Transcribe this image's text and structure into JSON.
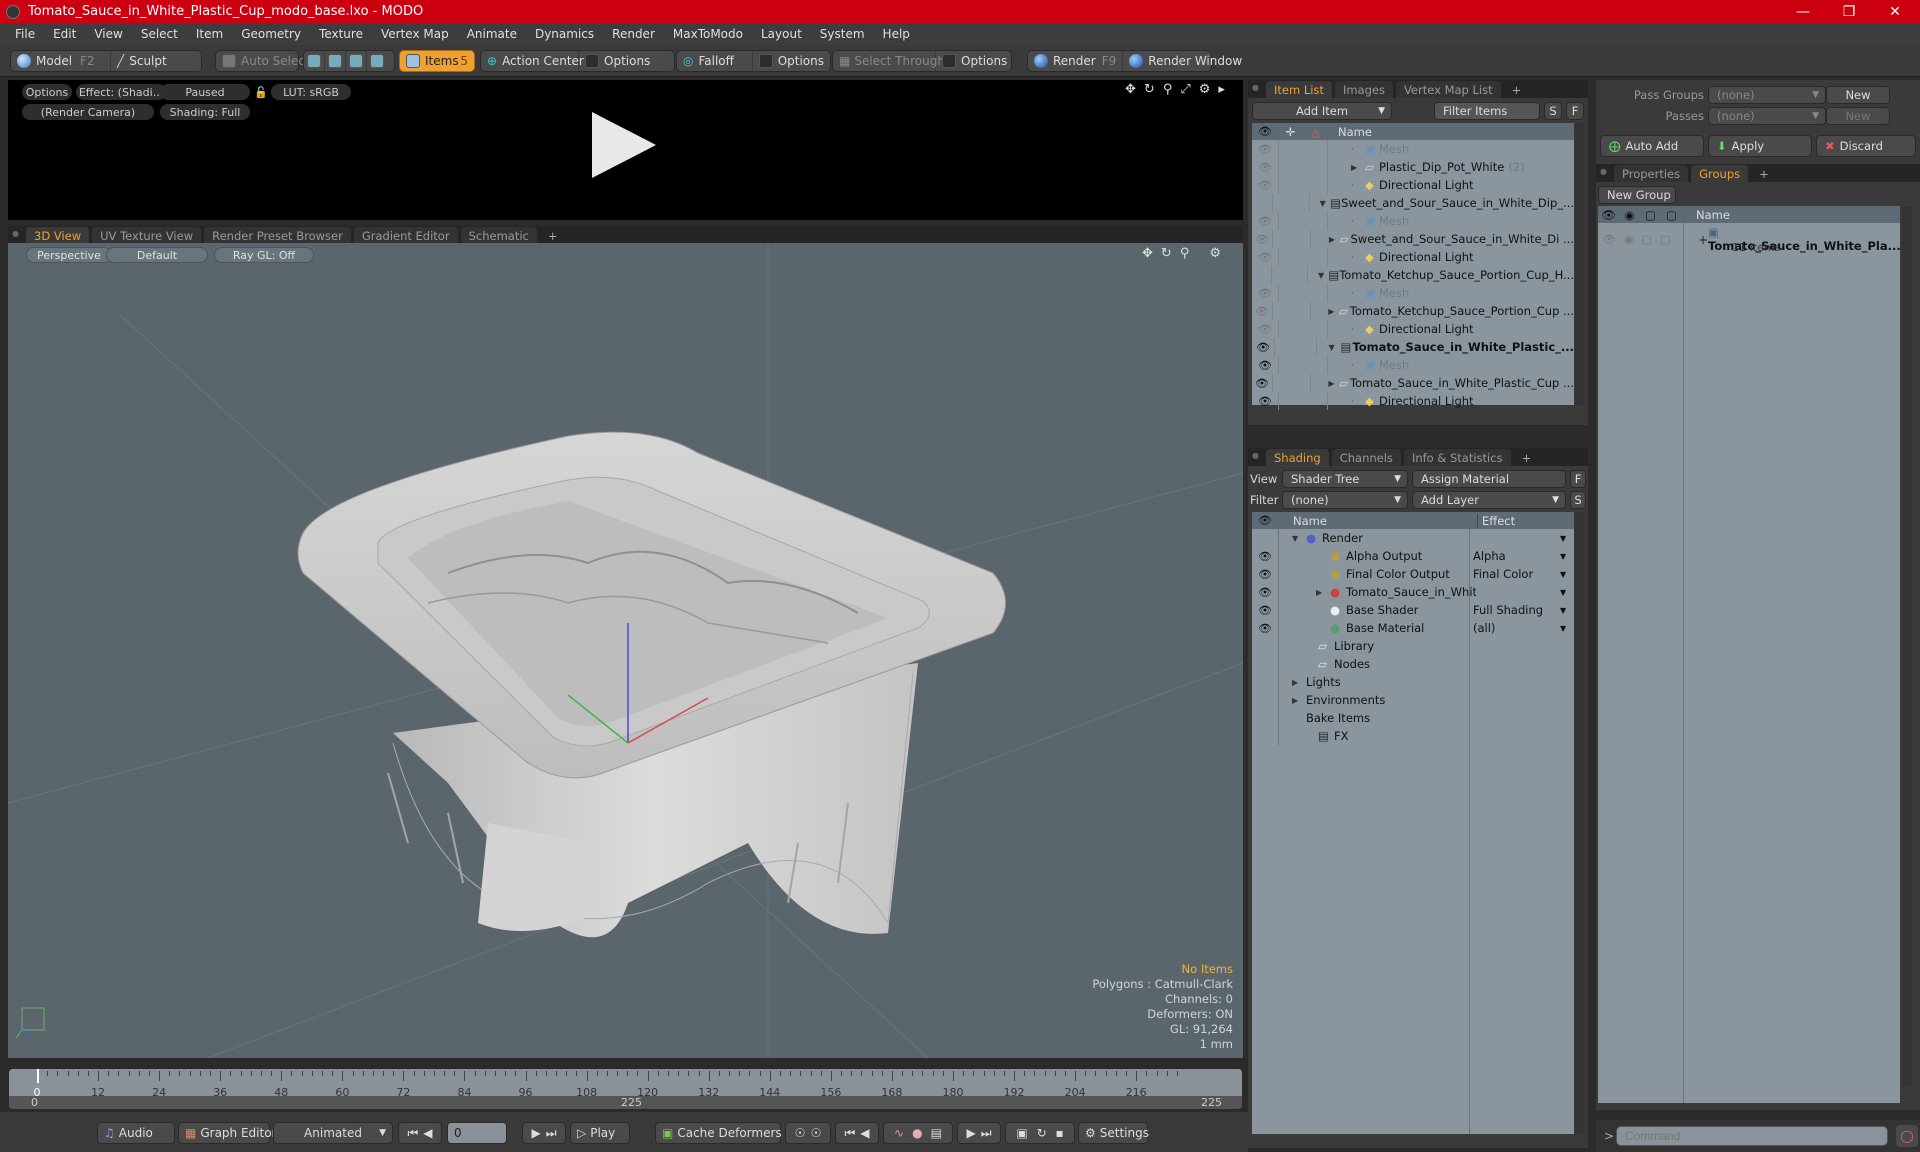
{
  "window": {
    "title": "Tomato_Sauce_in_White_Plastic_Cup_modo_base.lxo - MODO",
    "controls": [
      "minimize",
      "restore",
      "close"
    ]
  },
  "menu": [
    "File",
    "Edit",
    "View",
    "Select",
    "Item",
    "Geometry",
    "Texture",
    "Vertex Map",
    "Animate",
    "Dynamics",
    "Render",
    "MaxToModo",
    "Layout",
    "System",
    "Help"
  ],
  "toolbar": {
    "model": "Model",
    "model_key": "F2",
    "sculpt": "Sculpt",
    "auto_select": "Auto Select",
    "items": "Items",
    "items_key": "5",
    "action_center": "Action Center",
    "options1": "Options",
    "falloff": "Falloff",
    "options2": "Options",
    "select_through": "Select Through",
    "options3": "Options",
    "render": "Render",
    "render_key": "F9",
    "render_window": "Render Window"
  },
  "preview": {
    "options": "Options",
    "effect": "Effect: (Shadi...",
    "paused": "Paused",
    "lut": "LUT: sRGB",
    "camera": "(Render Camera)",
    "shading": "Shading: Full"
  },
  "viewport_tabs": [
    "3D View",
    "UV Texture View",
    "Render Preset Browser",
    "Gradient Editor",
    "Schematic",
    "+"
  ],
  "viewport": {
    "perspective": "Perspective",
    "default": "Default",
    "raygl": "Ray GL: Off",
    "info": {
      "items": "No Items",
      "polygons": "Polygons : Catmull-Clark",
      "channels": "Channels: 0",
      "deformers": "Deformers: ON",
      "gl": "GL: 91,264",
      "unit": "1 mm"
    }
  },
  "item_list": {
    "tabs": [
      "Item List",
      "Images",
      "Vertex Map List",
      "+"
    ],
    "add_item": "Add Item",
    "filter": "Filter Items",
    "s": "S",
    "f": "F",
    "col_name": "Name",
    "rows": [
      {
        "name": "Mesh",
        "indent": 2,
        "type": "mesh",
        "eye": "dim",
        "dim": true
      },
      {
        "name": "Plastic_Dip_Pot_White",
        "count": "(2)",
        "indent": 2,
        "type": "group",
        "eye": "dim",
        "expand": "right"
      },
      {
        "name": "Directional Light",
        "indent": 2,
        "type": "light",
        "eye": "dim"
      },
      {
        "name": "Sweet_and_Sour_Sauce_in_White_Dip_...",
        "indent": 1,
        "type": "scene",
        "eye": "none",
        "expand": "down"
      },
      {
        "name": "Mesh",
        "indent": 2,
        "type": "mesh",
        "eye": "dim",
        "dim": true
      },
      {
        "name": "Sweet_and_Sour_Sauce_in_White_Di ...",
        "indent": 2,
        "type": "group",
        "eye": "dim",
        "expand": "right"
      },
      {
        "name": "Directional Light",
        "indent": 2,
        "type": "light",
        "eye": "dim"
      },
      {
        "name": "Tomato_Ketchup_Sauce_Portion_Cup_H...",
        "indent": 1,
        "type": "scene",
        "eye": "none",
        "expand": "down"
      },
      {
        "name": "Mesh",
        "indent": 2,
        "type": "mesh",
        "eye": "dim",
        "dim": true
      },
      {
        "name": "Tomato_Ketchup_Sauce_Portion_Cup ...",
        "indent": 2,
        "type": "group",
        "eye": "dim",
        "expand": "right"
      },
      {
        "name": "Directional Light",
        "indent": 2,
        "type": "light",
        "eye": "dim"
      },
      {
        "name": "Tomato_Sauce_in_White_Plastic_...",
        "indent": 1,
        "type": "scene",
        "eye": "on",
        "expand": "down",
        "bold": true
      },
      {
        "name": "Mesh",
        "indent": 2,
        "type": "mesh",
        "eye": "on",
        "dim": true
      },
      {
        "name": "Tomato_Sauce_in_White_Plastic_Cup ...",
        "indent": 2,
        "type": "group",
        "eye": "on",
        "expand": "right"
      },
      {
        "name": "Directional Light",
        "indent": 2,
        "type": "light",
        "eye": "on"
      }
    ]
  },
  "shading": {
    "tabs": [
      "Shading",
      "Channels",
      "Info & Statistics",
      "+"
    ],
    "view_label": "View",
    "view_value": "Shader Tree",
    "assign_material": "Assign Material",
    "f": "F",
    "filter_label": "Filter",
    "filter_value": "(none)",
    "add_layer": "Add Layer",
    "s": "S",
    "col_name": "Name",
    "col_effect": "Effect",
    "rows": [
      {
        "name": "Render",
        "effect": "",
        "indent": 0,
        "icon": "render-sphere",
        "eye": false,
        "expand": "down"
      },
      {
        "name": "Alpha Output",
        "effect": "Alpha",
        "indent": 1,
        "icon": "output",
        "eye": true
      },
      {
        "name": "Final Color Output",
        "effect": "Final Color",
        "indent": 1,
        "icon": "output",
        "eye": true
      },
      {
        "name": "Tomato_Sauce_in_White_ ...",
        "effect": "",
        "indent": 1,
        "icon": "material-group",
        "eye": true,
        "expand": "right"
      },
      {
        "name": "Base Shader",
        "effect": "Full Shading",
        "indent": 1,
        "icon": "shader",
        "eye": true
      },
      {
        "name": "Base Material",
        "effect": "(all)",
        "indent": 1,
        "icon": "material",
        "eye": true
      },
      {
        "name": "Library",
        "effect": "",
        "indent": 0.5,
        "icon": "folder",
        "eye": false,
        "noeffect": true
      },
      {
        "name": "Nodes",
        "effect": "",
        "indent": 0.5,
        "icon": "folder",
        "eye": false,
        "noeffect": true
      },
      {
        "name": "Lights",
        "effect": "",
        "indent": 0,
        "icon": "",
        "eye": false,
        "expand": "right",
        "noeffect": true
      },
      {
        "name": "Environments",
        "effect": "",
        "indent": 0,
        "icon": "",
        "eye": false,
        "expand": "right",
        "noeffect": true
      },
      {
        "name": "Bake Items",
        "effect": "",
        "indent": 0,
        "icon": "",
        "eye": false,
        "noeffect": true
      },
      {
        "name": "FX",
        "effect": "",
        "indent": 0.5,
        "icon": "scene",
        "eye": false,
        "noeffect": true
      }
    ]
  },
  "passes": {
    "pass_groups_label": "Pass Groups",
    "pass_groups_value": "(none)",
    "new1": "New",
    "passes_label": "Passes",
    "passes_value": "(none)",
    "new2": "New",
    "auto_add": "Auto Add",
    "apply": "Apply",
    "discard": "Discard"
  },
  "groups": {
    "tabs": [
      "Properties",
      "Groups",
      "+"
    ],
    "new_group": "New Group",
    "col_name": "Name",
    "group_name": "Tomato_Sauce_in_White_Pla...",
    "group_count": "11 Items"
  },
  "timeline": {
    "ticks": [
      "0",
      "12",
      "24",
      "36",
      "48",
      "60",
      "72",
      "84",
      "96",
      "108",
      "120",
      "132",
      "144",
      "156",
      "168",
      "180",
      "192",
      "204",
      "216"
    ],
    "range_start": "0",
    "range_end_left": "225",
    "range_end_right": "225"
  },
  "transport": {
    "audio": "Audio",
    "graph_editor": "Graph Editor",
    "animated": "Animated",
    "frame": "0",
    "play": "Play",
    "cache_deformers": "Cache Deformers",
    "settings": "Settings"
  },
  "command": {
    "placeholder": "Command",
    "prompt": ">"
  }
}
